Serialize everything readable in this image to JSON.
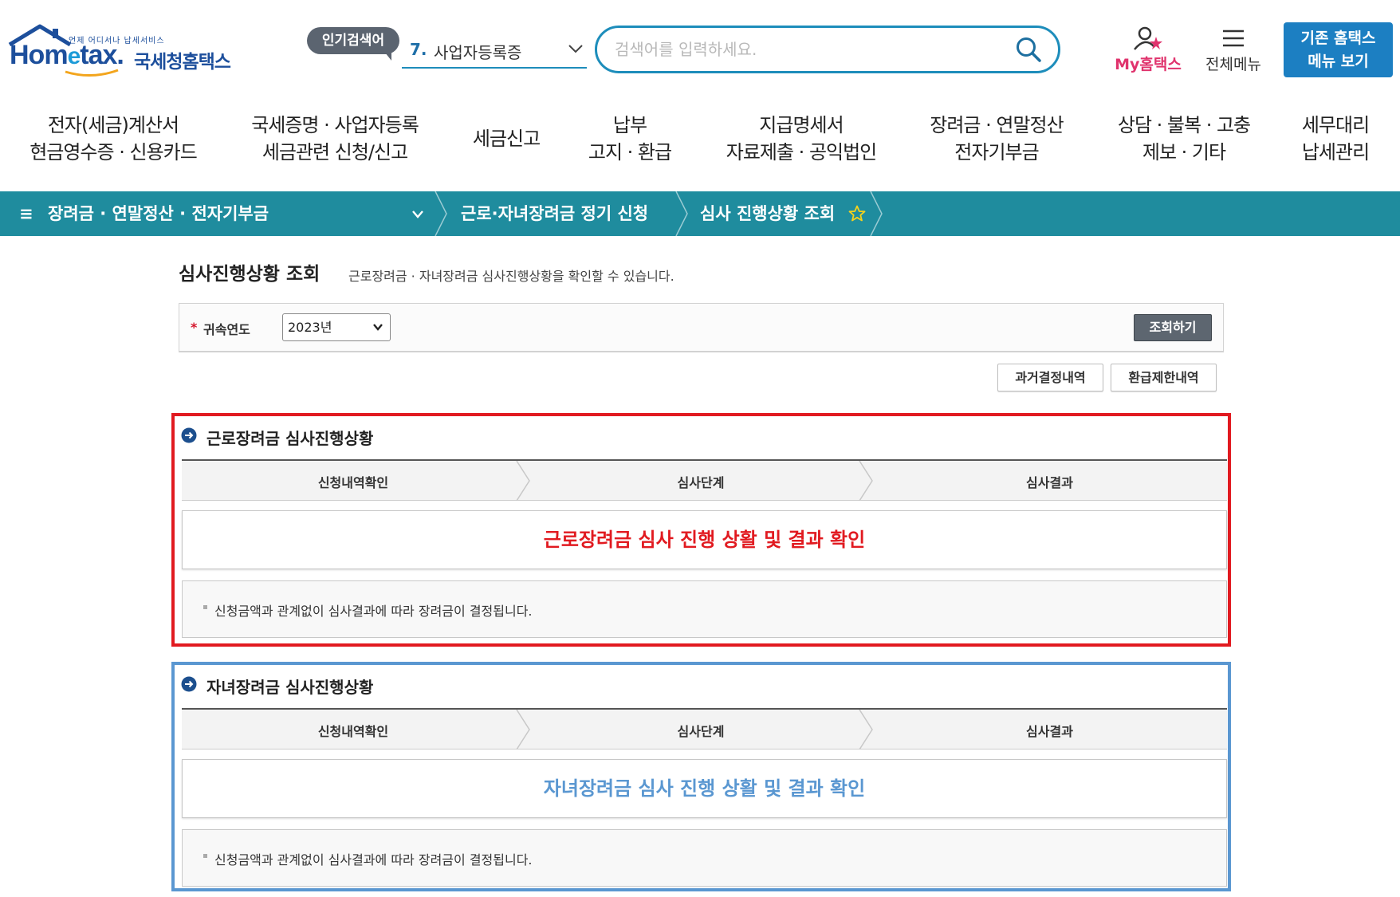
{
  "header": {
    "logo_small": "언제 어디서나 납세서비스",
    "logo_main_a": "Hom",
    "logo_main_e": "e",
    "logo_main_b": "tax.",
    "logo_kr": "국세청홈택스",
    "popular_badge": "인기검색어",
    "popular_num": "7.",
    "popular_text": "사업자등록증",
    "search_placeholder": "검색어를 입력하세요.",
    "my_hometax": "My홈택스",
    "all_menu": "전체메뉴",
    "legacy_line1": "기존 홈택스",
    "legacy_line2": "메뉴 보기"
  },
  "nav": [
    {
      "l1": "전자(세금)계산서",
      "l2": "현금영수증 · 신용카드"
    },
    {
      "l1": "국세증명 · 사업자등록",
      "l2": "세금관련 신청/신고"
    },
    {
      "l1": "세금신고",
      "l2": ""
    },
    {
      "l1": "납부",
      "l2": "고지 · 환급"
    },
    {
      "l1": "지급명세서",
      "l2": "자료제출 · 공익법인"
    },
    {
      "l1": "장려금 · 연말정산",
      "l2": "전자기부금"
    },
    {
      "l1": "상담 · 불복 · 고충",
      "l2": "제보 · 기타"
    },
    {
      "l1": "세무대리",
      "l2": "납세관리"
    }
  ],
  "breadcrumb": {
    "menu_icon": "≡",
    "item1": "장려금 · 연말정산 · 전자기부금",
    "item2": "근로·자녀장려금 정기 신청",
    "item3": "심사 진행상황 조회"
  },
  "page": {
    "title": "심사진행상황 조회",
    "desc": "근로장려금 · 자녀장려금 심사진행상황을 확인할 수 있습니다."
  },
  "filter": {
    "required_mark": "*",
    "label": "귀속연도",
    "year_value": "2023년",
    "query_button": "조회하기"
  },
  "sub_buttons": {
    "past": "과거결정내역",
    "refund_limit": "환급제한내역"
  },
  "panels": [
    {
      "title": "근로장려금 심사진행상황",
      "steps": [
        "신청내역확인",
        "심사단계",
        "심사결과"
      ],
      "result_text": "근로장려금 심사 진행 상활 및 결과 확인",
      "result_color": "#e11a20",
      "note": "신청금액과 관계없이 심사결과에 따라 장려금이 결정됩니다."
    },
    {
      "title": "자녀장려금 심사진행상황",
      "steps": [
        "신청내역확인",
        "심사단계",
        "심사결과"
      ],
      "result_text": "자녀장려금 심사 진행 상활 및 결과 확인",
      "result_color": "#5a97d1",
      "note": "신청금액과 관계없이 심사결과에 따라 장려금이 결정됩니다."
    }
  ],
  "colors": {
    "brand_blue": "#1d4f9c",
    "teal_bar": "#1f8c9e",
    "accent_pink": "#e0336d",
    "legacy_button": "#1c7fc2"
  }
}
